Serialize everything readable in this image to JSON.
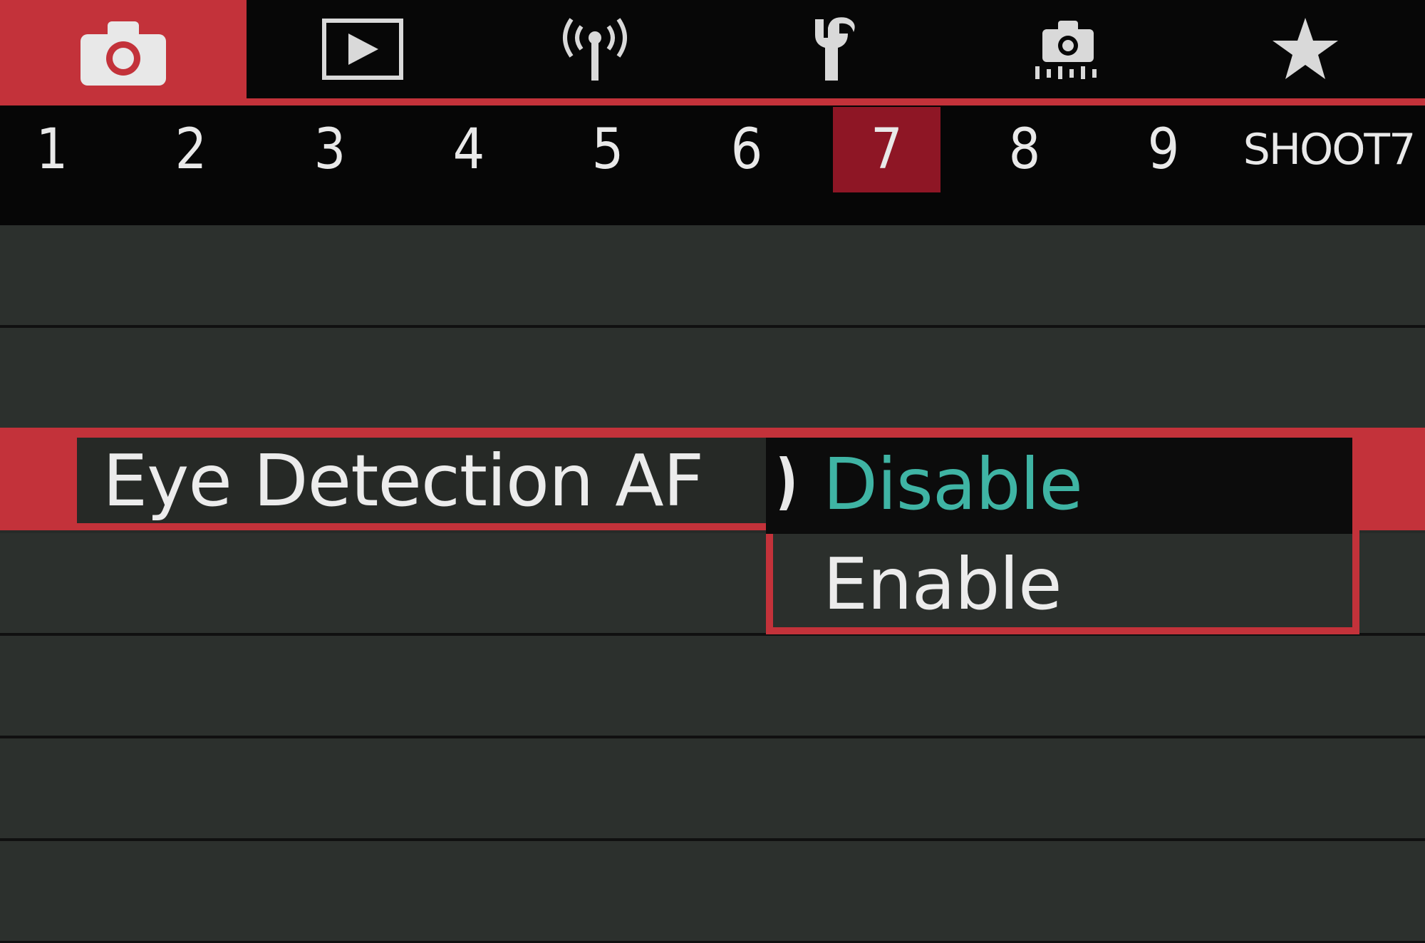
{
  "category_tabs": [
    {
      "icon": "camera-shooting-icon",
      "active": true
    },
    {
      "icon": "playback-icon",
      "active": false
    },
    {
      "icon": "wireless-icon",
      "active": false
    },
    {
      "icon": "wrench-setup-icon",
      "active": false
    },
    {
      "icon": "custom-functions-camera-icon",
      "active": false
    },
    {
      "icon": "star-my-menu-icon",
      "active": false
    }
  ],
  "number_tabs": [
    "1",
    "2",
    "3",
    "4",
    "5",
    "6",
    "7",
    "8",
    "9"
  ],
  "active_number_tab": "7",
  "page_label": "SHOOT7",
  "menu": {
    "selected_item": "Eye Detection AF",
    "options": [
      {
        "label": "Disable",
        "selected": true
      },
      {
        "label": "Enable",
        "selected": false
      }
    ]
  },
  "colors": {
    "accent_red": "#c3323a",
    "active_tab_red": "#8e1625",
    "selected_option_teal": "#3fb4a4",
    "background": "#2c302d"
  }
}
